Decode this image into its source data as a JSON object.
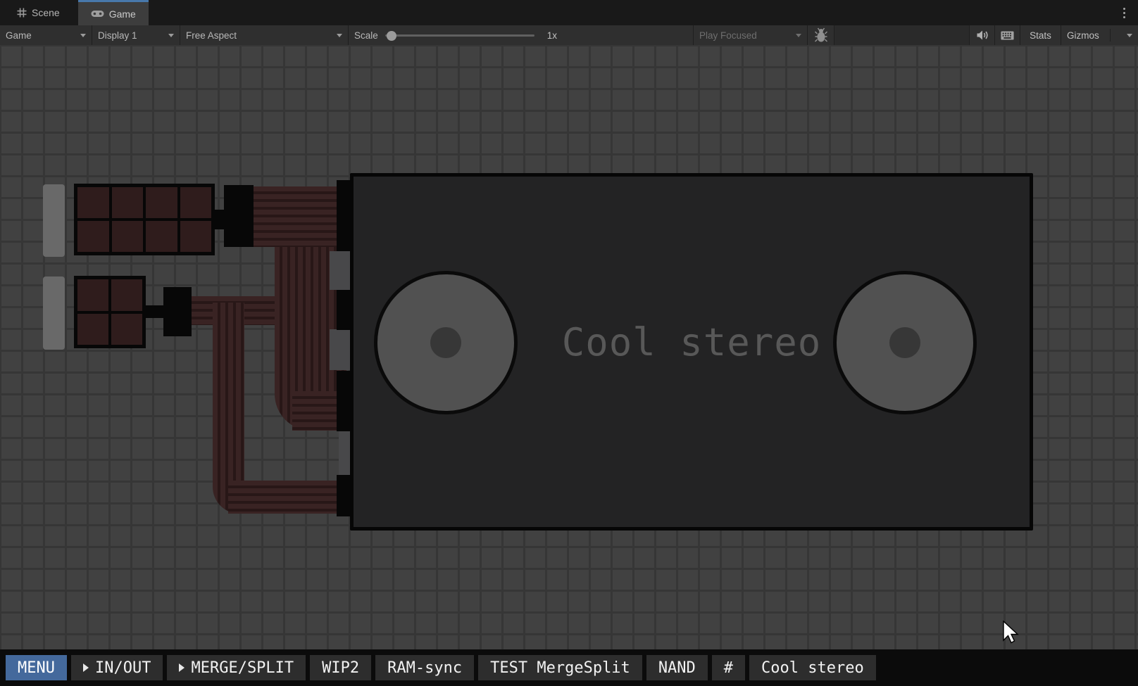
{
  "tab_bar": {
    "tabs": [
      {
        "label": "Scene"
      },
      {
        "label": "Game"
      }
    ]
  },
  "toolbar": {
    "game_menu": "Game",
    "display": "Display 1",
    "aspect": "Free Aspect",
    "scale_label": "Scale",
    "scale_value": "1x",
    "play_behavior": "Play Focused",
    "stats": "Stats",
    "gizmos": "Gizmos"
  },
  "game": {
    "chip_label": "Cool stereo"
  },
  "bottom_menu": {
    "items": [
      {
        "label": "MENU",
        "active": true
      },
      {
        "label": "IN/OUT",
        "submenu": true
      },
      {
        "label": "MERGE/SPLIT",
        "submenu": true
      },
      {
        "label": "WIP2"
      },
      {
        "label": "RAM-sync"
      },
      {
        "label": "TEST MergeSplit"
      },
      {
        "label": "NAND"
      },
      {
        "label": "#"
      },
      {
        "label": "Cool stereo"
      }
    ]
  },
  "icons": [
    "scene-grid-icon",
    "gamepad-icon",
    "kebab-menu-icon",
    "dropdown-caret-icon",
    "bug-icon",
    "speaker-icon",
    "keyboard-icon",
    "submenu-arrow-icon",
    "mouse-cursor"
  ],
  "colors": {
    "tab_accent": "#4878ab",
    "menu_active": "#44699c",
    "wire_light": "#392323",
    "wire_dark": "#281717",
    "module_fill": "#2f1c1c",
    "chip_fill": "#232324",
    "knob_fill": "#515151",
    "chip_text": "#585858",
    "grid_cell": "#414141",
    "grid_line": "#363636"
  }
}
